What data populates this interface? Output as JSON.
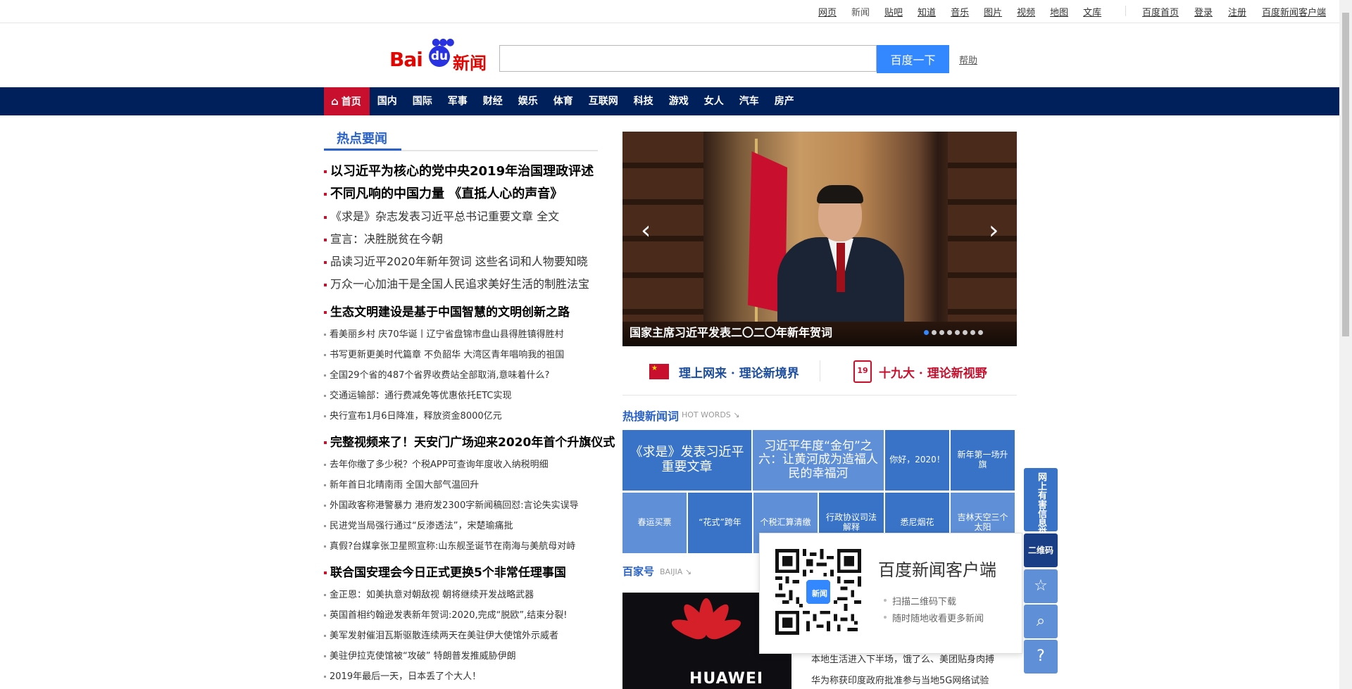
{
  "topbar": {
    "links": [
      "网页",
      "新闻",
      "贴吧",
      "知道",
      "音乐",
      "图片",
      "视频",
      "地图",
      "文库"
    ],
    "right_links": [
      "百度首页",
      "登录",
      "注册",
      "百度新闻客户端"
    ]
  },
  "header": {
    "logo_bai": "Bai",
    "logo_du": "du",
    "logo_news": "新闻",
    "search_placeholder": "",
    "search_button": "百度一下",
    "help": "帮助"
  },
  "nav": {
    "home": "首页",
    "items": [
      "国内",
      "国际",
      "军事",
      "财经",
      "娱乐",
      "体育",
      "互联网",
      "科技",
      "游戏",
      "女人",
      "汽车",
      "房产"
    ]
  },
  "hot": {
    "title": "热点要闻",
    "group1": [
      "以习近平为核心的党中央2019年治国理政评述",
      "不同凡响的中国力量 《直抵人心的声音》",
      "《求是》杂志发表习近平总书记重要文章 全文",
      "宣言：决胜脱贫在今朝",
      "品读习近平2020年新年贺词 这些名词和人物要知晓",
      "万众一心加油干是全国人民追求美好生活的制胜法宝"
    ],
    "lead2": "生态文明建设是基于中国智慧的文明创新之路",
    "list2": [
      "看美丽乡村 庆70华诞丨辽宁省盘锦市盘山县得胜镇得胜村",
      "书写更新更美时代篇章 不负韶华 大湾区青年唱响我的祖国",
      "全国29个省的487个省界收费站全部取消,意味着什么?",
      "交通运输部：通行费减免等优惠依托ETC实现",
      "央行宣布1月6日降准，释放资金8000亿元"
    ],
    "lead3": "完整视频来了！天安门广场迎来2020年首个升旗仪式",
    "list3": [
      "去年你缴了多少税？个税APP可查询年度收入纳税明细",
      "新年首日北晴南雨 全国大部气温回升",
      "外国政客称港警暴力 港府发2300字新闻稿回怼:言论失实误导",
      "民进党当局强行通过“反渗透法”，宋楚瑜痛批",
      "真假?台媒拿张卫星照宣称:山东舰圣诞节在南海与美航母对峙"
    ],
    "lead4": "联合国安理会今日正式更换5个非常任理事国",
    "list4": [
      "金正恩：如美执意对朝敌视 朝将继续开发战略武器",
      "英国首相约翰逊发表新年贺词:2020,完成“脱欧”,结束分裂!",
      "美军发射催泪瓦斯驱散连续两天在美驻伊大使馆外示威者",
      "美驻伊拉克使馆被“攻破” 特朗普发推威胁伊朗",
      "2019年最后一天，日本丢了个大人！"
    ]
  },
  "carousel": {
    "caption": "国家主席习近平发表二〇二〇年新年贺词",
    "slides": 8,
    "active": 1
  },
  "promos": {
    "left": "理上网来 · 理论新境界",
    "right": "十九大 · 理论新视野",
    "badge": "19"
  },
  "hotwords": {
    "title": "热搜新闻词",
    "sub": "HOT WORDS",
    "tiles": [
      "《求是》发表习近平重要文章",
      "习近平年度“金句”之六：让黄河成为造福人民的幸福河",
      "你好，2020！",
      "新年第一场升旗",
      "春运买票",
      "“花式”跨年",
      "个税汇算清缴",
      "行政协议司法解释",
      "悉尼烟花",
      "吉林天空三个太阳"
    ]
  },
  "baijia": {
    "title": "百家号",
    "sub": "BAIJIA",
    "brand": "HUAWEI",
    "lines": [
      "本地生活进入下半场，饿了么、美团贴身肉搏",
      "华为称获印度政府批准参与当地5G网络试验"
    ]
  },
  "qr": {
    "title": "百度新闻客户端",
    "items": [
      "扫描二维码下载",
      "随时随地收看更多新闻"
    ],
    "center": "新闻"
  },
  "float": {
    "report": "网上有害信息举报",
    "qr": "二维码"
  }
}
